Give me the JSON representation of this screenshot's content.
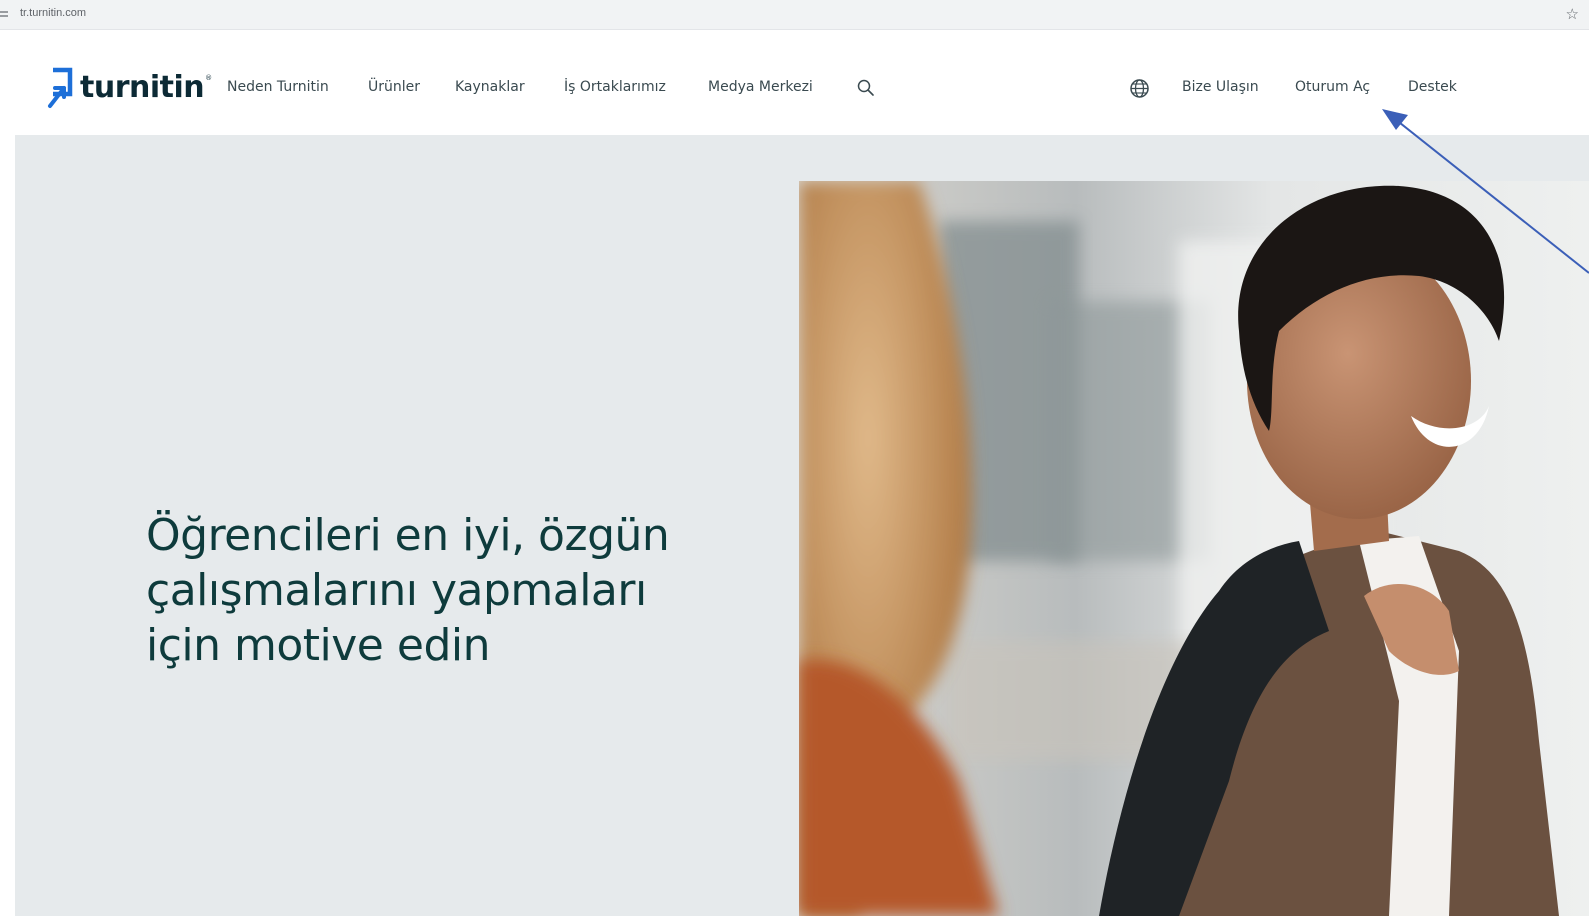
{
  "browser": {
    "url": "tr.turnitin.com",
    "icons": {
      "site_settings": "tune-icon",
      "bookmark": "star-icon"
    }
  },
  "header": {
    "logo_text": "turnitin",
    "logo_trademark": "®",
    "nav": [
      {
        "label": "Neden Turnitin"
      },
      {
        "label": "Ürünler"
      },
      {
        "label": "Kaynaklar"
      },
      {
        "label": "İş Ortaklarımız"
      },
      {
        "label": "Medya Merkezi"
      }
    ],
    "icons": {
      "search": "search-icon",
      "language": "globe-icon"
    },
    "right_links": [
      {
        "label": "Bize Ulaşın"
      },
      {
        "label": "Oturum Aç"
      },
      {
        "label": "Destek"
      }
    ]
  },
  "hero": {
    "heading_lines": [
      "Öğrencileri en iyi, özgün",
      "çalışmalarını yapmaları",
      "için motive edin"
    ]
  },
  "colors": {
    "brand_blue": "#1d6fd8",
    "heading_teal": "#0e3b3c",
    "hero_bg": "#e6eaec",
    "annotation_arrow": "#3b5fb8"
  }
}
